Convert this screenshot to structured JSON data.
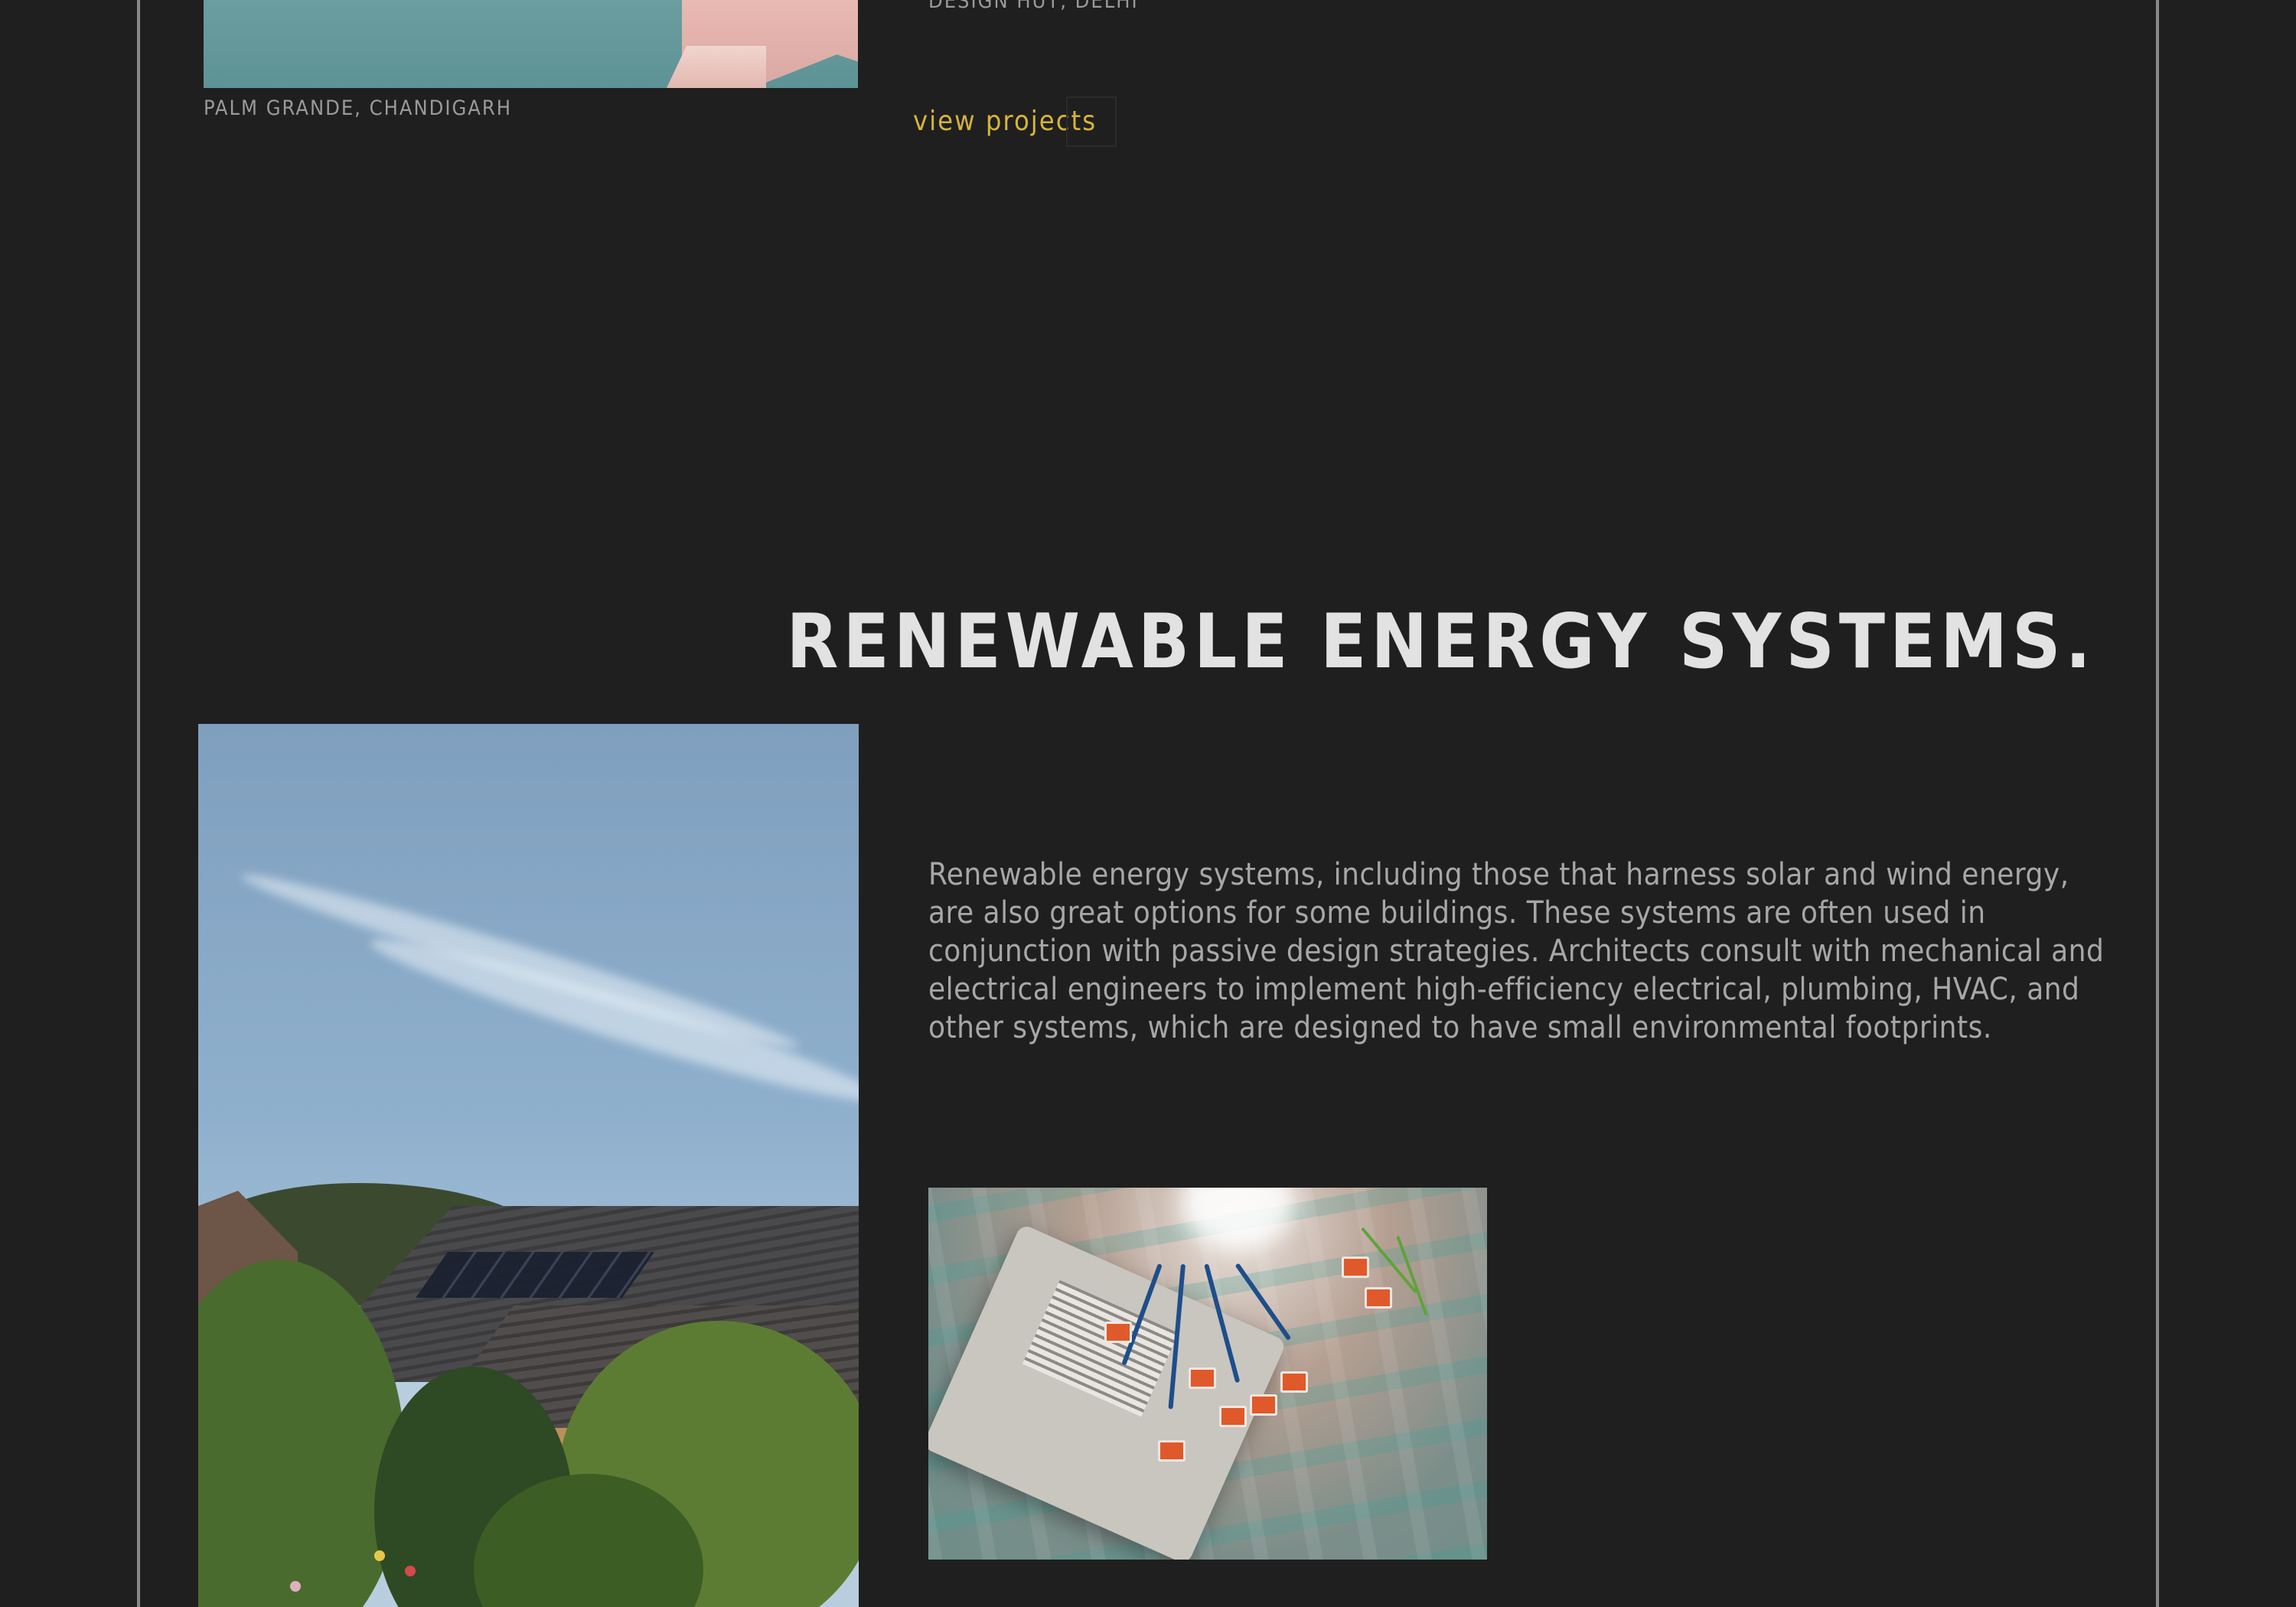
{
  "previous_project": {
    "caption_left": "PALM GRANDE, CHANDIGARH",
    "caption_right": "DESIGN HUT, DELHI",
    "view_projects_label": "view projects",
    "accent_color": "#d6b43a"
  },
  "section": {
    "title": "RENEWABLE ENERGY SYSTEMS.",
    "description": "Renewable energy systems, including those that harness solar and wind energy, are also great options for some buildings. These systems are often used in conjunction with passive design strategies. Architects consult with mechanical and electrical engineers to implement high-efficiency electrical, plumbing, HVAC, and other systems, which are designed to have small environmental footprints.",
    "main_image_subject": "house-with-solar-panels-photo",
    "secondary_image_subject": "electrical-wiring-connectors-photo"
  },
  "theme": {
    "background": "#1f1f1f",
    "frame_line": "#8a8a8a",
    "title_color": "#e2e2e2",
    "text_color": "#a7a7a7"
  }
}
